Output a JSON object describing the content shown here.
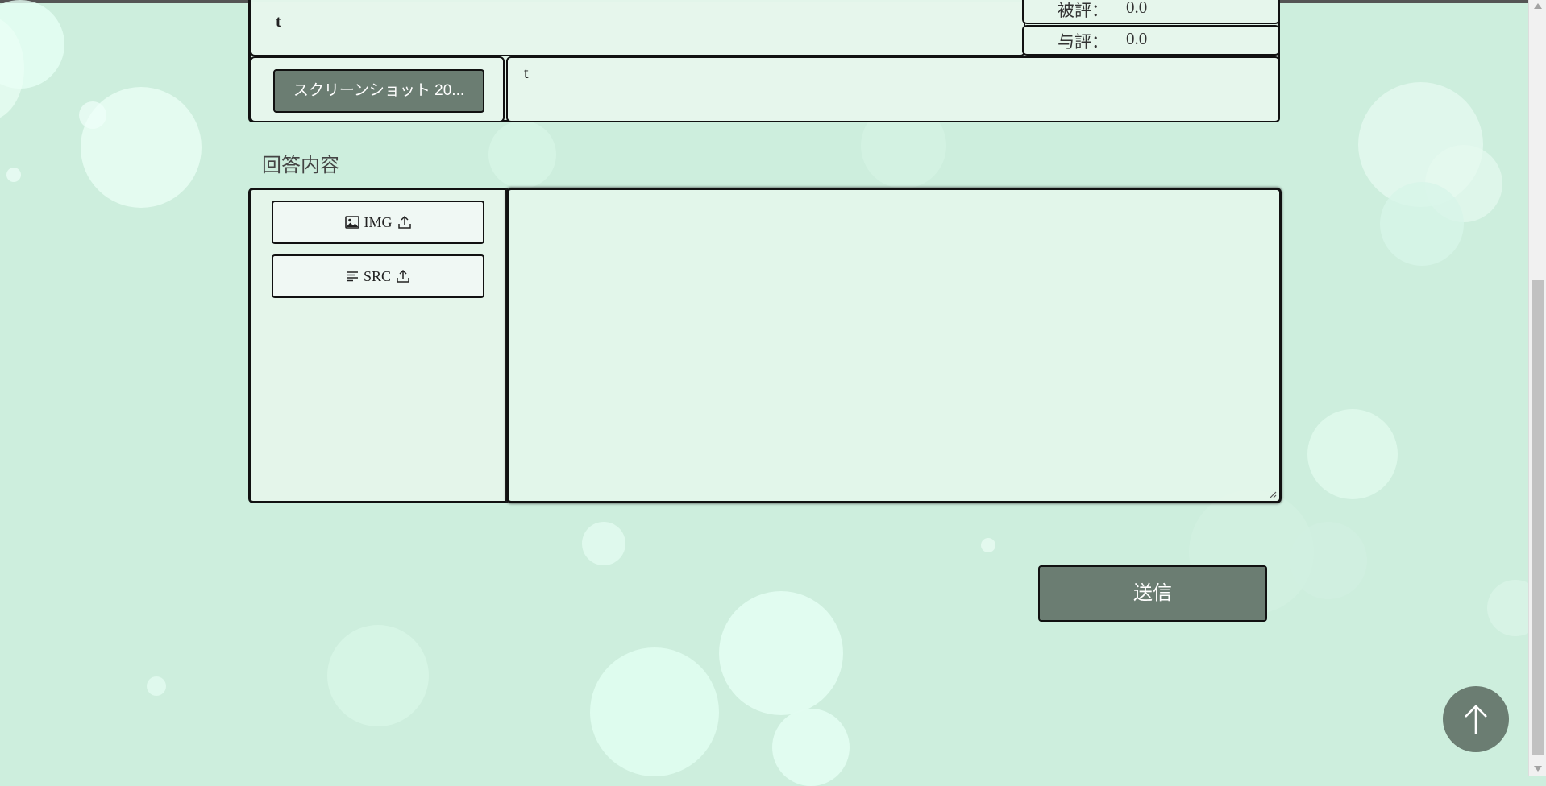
{
  "question": {
    "title": "t",
    "body": "t",
    "received_rating_label": "被評：",
    "received_rating_value": "0.0",
    "given_rating_label": "与評：",
    "given_rating_value": "0.0",
    "attachment_label": "スクリーンショット 20..."
  },
  "answer": {
    "section_label": "回答内容",
    "img_upload_label": "IMG",
    "src_upload_label": "SRC",
    "textarea_value": ""
  },
  "submit_label": "送信",
  "icons": {
    "img": "image-icon",
    "src": "text-lines-icon",
    "upload": "upload-icon",
    "top": "arrow-up-icon"
  },
  "colors": {
    "background": "#cdeedd",
    "button_dark": "#6b7d72",
    "panel": "#e6f6ec"
  }
}
